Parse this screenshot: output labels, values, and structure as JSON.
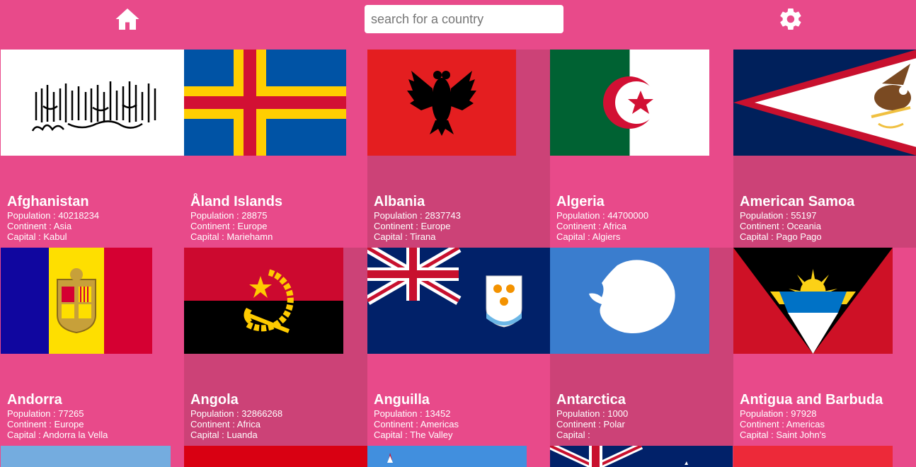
{
  "header": {
    "search_placeholder": "search for a country",
    "home_icon": "home-icon",
    "settings_icon": "gear-icon"
  },
  "labels": {
    "population": "Population : ",
    "continent": "Continent : ",
    "capital": "Capital : "
  },
  "countries": [
    {
      "name": "Afghanistan",
      "population": "40218234",
      "continent": "Asia",
      "capital": "Kabul"
    },
    {
      "name": "Åland Islands",
      "population": "28875",
      "continent": "Europe",
      "capital": "Mariehamn"
    },
    {
      "name": "Albania",
      "population": "2837743",
      "continent": "Europe",
      "capital": "Tirana"
    },
    {
      "name": "Algeria",
      "population": "44700000",
      "continent": "Africa",
      "capital": "Algiers"
    },
    {
      "name": "American Samoa",
      "population": "55197",
      "continent": "Oceania",
      "capital": "Pago Pago"
    },
    {
      "name": "Andorra",
      "population": "77265",
      "continent": "Europe",
      "capital": "Andorra la Vella"
    },
    {
      "name": "Angola",
      "population": "32866268",
      "continent": "Africa",
      "capital": "Luanda"
    },
    {
      "name": "Anguilla",
      "population": "13452",
      "continent": "Americas",
      "capital": "The Valley"
    },
    {
      "name": "Antarctica",
      "population": "1000",
      "continent": "Polar",
      "capital": ""
    },
    {
      "name": "Antigua and Barbuda",
      "population": "97928",
      "continent": "Americas",
      "capital": "Saint John's"
    }
  ],
  "colors": {
    "background": "#e84a8a",
    "card_dark": "#cc4277",
    "card_text": "#ffffff"
  }
}
